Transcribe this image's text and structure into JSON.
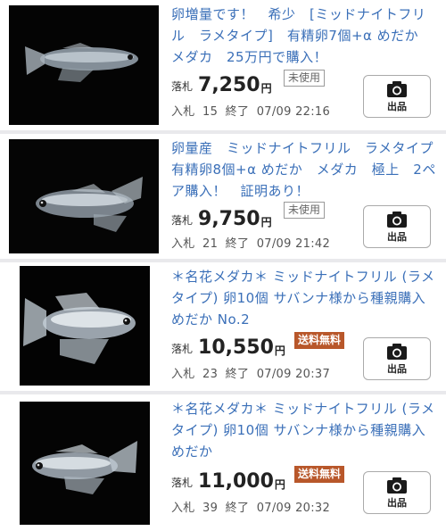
{
  "items": [
    {
      "title": "卵増量です！　希少　[ミッドナイトフリル　ラメタイプ]　有精卵7個+α めだか　メダカ　25万円で購入！",
      "price_label": "落札",
      "price": "7,250",
      "currency": "円",
      "badge": "未使用",
      "badge_type": "used",
      "bids_label": "入札",
      "bids": "15",
      "end_label": "終了",
      "end_time": "07/09 22:16",
      "sell_label": "出品",
      "sell_icon": "camera-icon"
    },
    {
      "title": "卵量産　ミッドナイトフリル　ラメタイプ　有精卵8個+α めだか　メダカ　極上　2ペア購入！　証明あり！",
      "price_label": "落札",
      "price": "9,750",
      "currency": "円",
      "badge": "未使用",
      "badge_type": "used",
      "bids_label": "入札",
      "bids": "21",
      "end_label": "終了",
      "end_time": "07/09 21:42",
      "sell_label": "出品",
      "sell_icon": "camera-icon"
    },
    {
      "title": "＊名花メダカ＊ ミッドナイトフリル (ラメタイプ) 卵10個 サバンナ様から種親購入 めだか No.2",
      "price_label": "落札",
      "price": "10,550",
      "currency": "円",
      "badge": "送料無料",
      "badge_type": "shipping",
      "bids_label": "入札",
      "bids": "23",
      "end_label": "終了",
      "end_time": "07/09 20:37",
      "sell_label": "出品",
      "sell_icon": "camera-icon"
    },
    {
      "title": "＊名花メダカ＊ ミッドナイトフリル (ラメタイプ) 卵10個 サバンナ様から種親購入 めだか",
      "price_label": "落札",
      "price": "11,000",
      "currency": "円",
      "badge": "送料無料",
      "badge_type": "shipping",
      "bids_label": "入札",
      "bids": "39",
      "end_label": "終了",
      "end_time": "07/09 20:32",
      "sell_label": "出品",
      "sell_icon": "camera-icon"
    }
  ],
  "colors": {
    "title_link": "#3a6fb8",
    "shipping_badge": "#b8572a",
    "background": "#e9e9ec"
  }
}
